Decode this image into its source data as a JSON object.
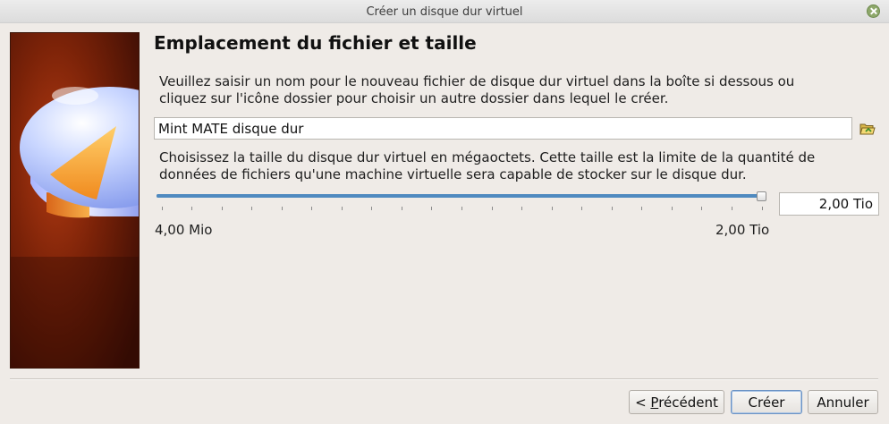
{
  "window": {
    "title": "Créer un disque dur virtuel"
  },
  "page": {
    "heading": "Emplacement du fichier et taille",
    "location_description_line1": "Veuillez saisir un nom pour le nouveau fichier de disque dur virtuel dans la boîte si dessous ou",
    "location_description_line2": "cliquez sur l'icône dossier pour choisir un autre dossier dans lequel le créer.",
    "file_name": "Mint MATE disque dur",
    "size_description_line1": "Choisissez la taille du disque dur virtuel en mégaoctets. Cette taille est la limite de la quantité de",
    "size_description_line2": "données de fichiers qu'une machine virtuelle sera capable de stocker sur le disque dur.",
    "size_value": "2,00 Tio",
    "slider": {
      "value_fraction": 1.0,
      "tick_count": 20
    },
    "size_min_label": "4,00 Mio",
    "size_max_label": "2,00 Tio"
  },
  "buttons": {
    "back_prefix": "< ",
    "back_mnemonic": "P",
    "back_rest": "récédent",
    "create": "Créer",
    "cancel": "Annuler"
  },
  "icons": {
    "close": "close-icon",
    "folder": "folder-open-icon",
    "banner": "hard-disk-illustration"
  },
  "colors": {
    "window_bg": "#efebe7",
    "slider_fill": "#4f8ac0",
    "banner_dark": "#5a1a0a",
    "disk_top": "#8fa9f0",
    "disk_wedge": "#f2a93b"
  }
}
